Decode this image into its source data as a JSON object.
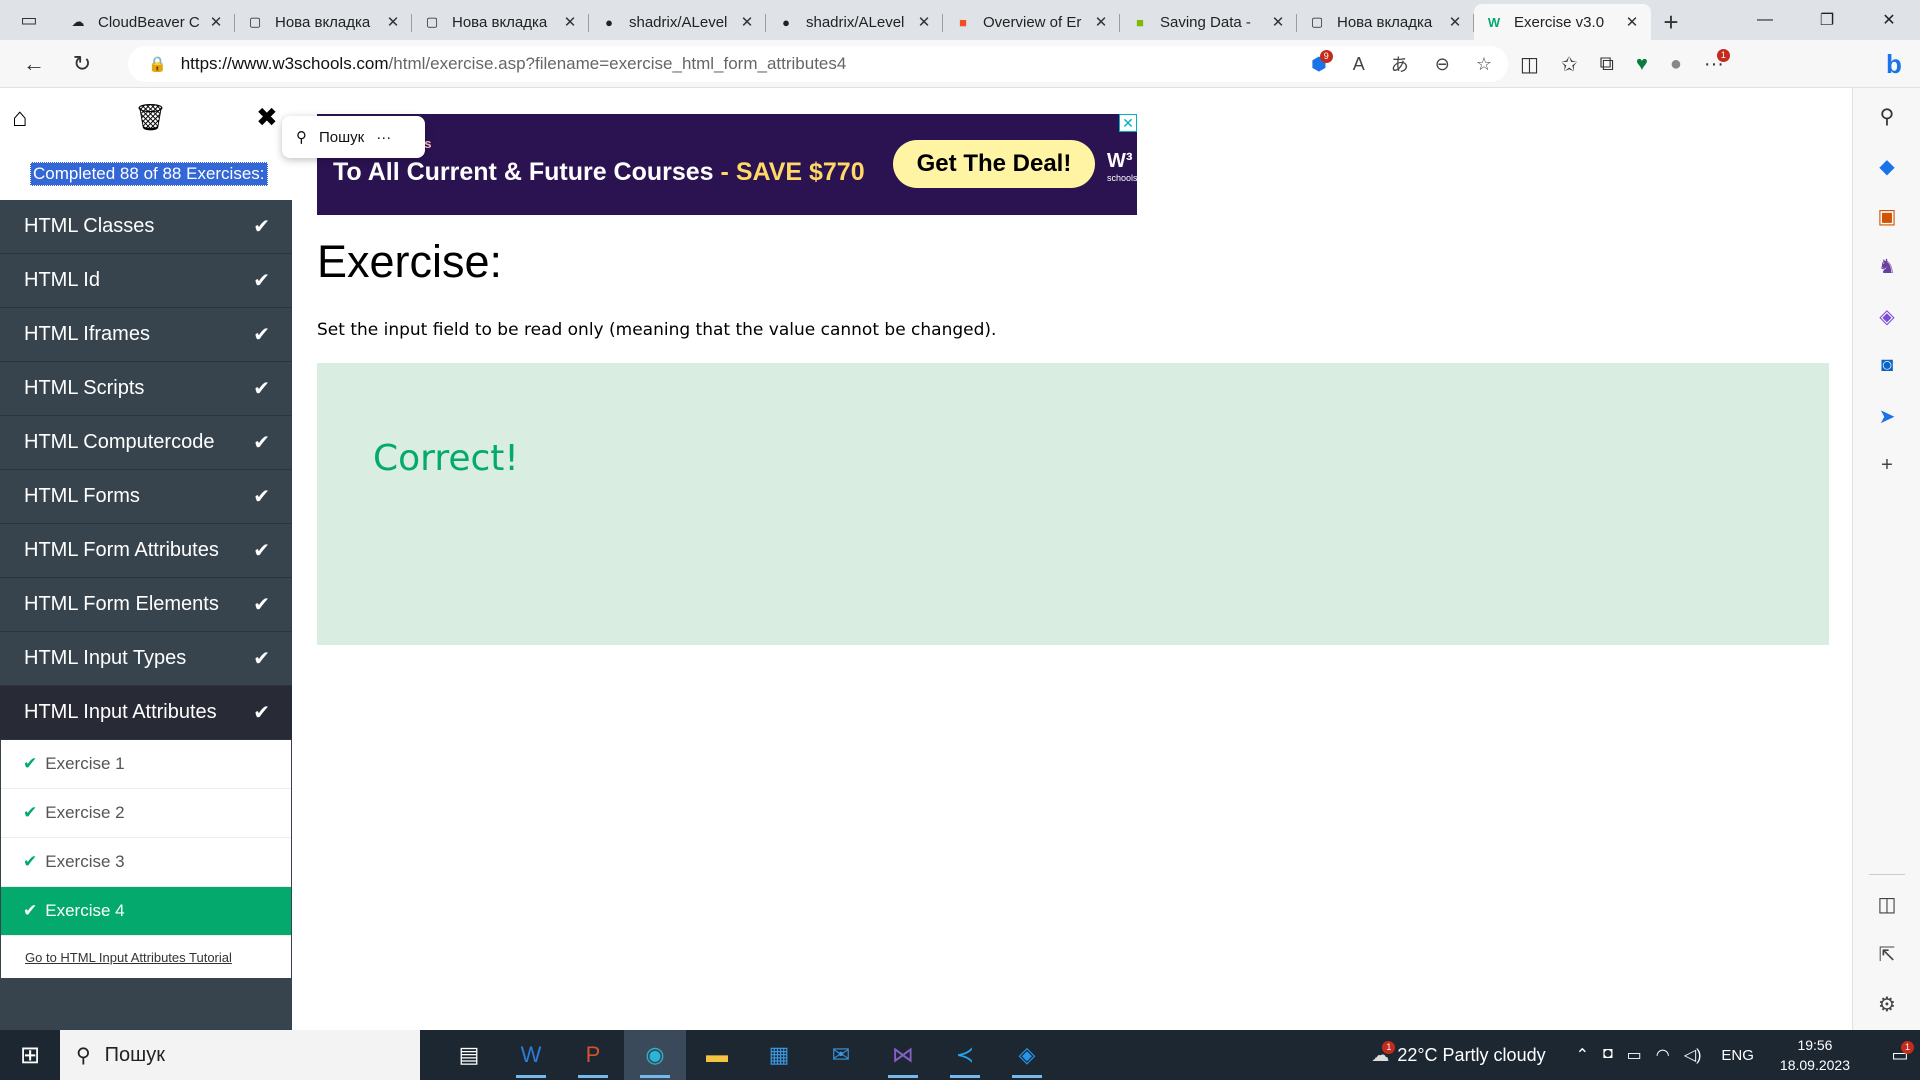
{
  "browser": {
    "tabs": [
      {
        "label": "CloudBeaver C",
        "icon": "cloudbeaver-icon",
        "active": false
      },
      {
        "label": "Нова вкладка",
        "icon": "page-icon",
        "active": false
      },
      {
        "label": "Нова вкладка",
        "icon": "page-icon",
        "active": false
      },
      {
        "label": "shadrix/ALevel",
        "icon": "github-icon",
        "active": false
      },
      {
        "label": "shadrix/ALevel",
        "icon": "github-icon",
        "active": false
      },
      {
        "label": "Overview of Er",
        "icon": "microsoft-icon",
        "active": false
      },
      {
        "label": "Saving Data -",
        "icon": "microsoft-icon",
        "active": false
      },
      {
        "label": "Нова вкладка",
        "icon": "page-icon",
        "active": false
      },
      {
        "label": "Exercise v3.0",
        "icon": "w3schools-icon",
        "active": true
      }
    ],
    "url_host": "https://www.w3schools.com",
    "url_path": "/html/exercise.asp?filename=exercise_html_form_attributes4",
    "extension_badge": "9",
    "menu_badge": "1"
  },
  "sidebar": {
    "completed": "Completed 88 of 88 Exercises:",
    "topics": [
      {
        "label": "HTML Classes"
      },
      {
        "label": "HTML Id"
      },
      {
        "label": "HTML Iframes"
      },
      {
        "label": "HTML Scripts"
      },
      {
        "label": "HTML Computercode"
      },
      {
        "label": "HTML Forms"
      },
      {
        "label": "HTML Form Attributes"
      },
      {
        "label": "HTML Form Elements"
      },
      {
        "label": "HTML Input Types"
      },
      {
        "label": "HTML Input Attributes"
      }
    ],
    "exercises": [
      {
        "label": "Exercise 1"
      },
      {
        "label": "Exercise 2"
      },
      {
        "label": "Exercise 3"
      },
      {
        "label": "Exercise 4"
      }
    ],
    "tutorial_link": "Go to HTML Input Attributes Tutorial"
  },
  "search_popup": {
    "label": "Пошук",
    "more": "···"
  },
  "ad": {
    "small_text": "ss",
    "headline": "To All Current & Future Courses",
    "save": "- SAVE $770",
    "button": "Get The Deal!",
    "logo": "W³",
    "logo_sub": "schools"
  },
  "exercise": {
    "title": "Exercise:",
    "description": "Set the input field to be read only (meaning that the value cannot be changed).",
    "result": "Correct!"
  },
  "taskbar": {
    "search_placeholder": "Пошук",
    "weather": "22°C  Partly cloudy",
    "weather_badge": "1",
    "language": "ENG",
    "time": "19:56",
    "date": "18.09.2023",
    "notification_count": "1"
  },
  "colors": {
    "accent": "#04aa6d",
    "sidebar_bg": "#38444d",
    "result_bg": "#d9eee1",
    "ad_bg": "#2b1352"
  }
}
